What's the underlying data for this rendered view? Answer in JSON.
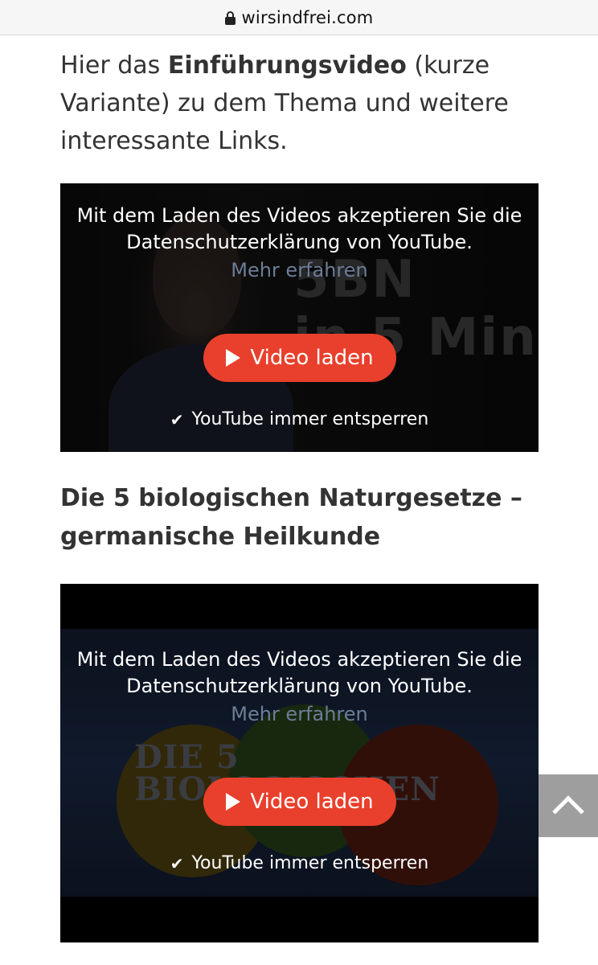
{
  "browser": {
    "url": "wirsindfrei.com"
  },
  "intro": {
    "text_before": "Hier das ",
    "bold": "Einführungsvideo",
    "text_after": " (kurze Variante) zu dem Thema und weitere interessante Links."
  },
  "video1": {
    "thumb_line1": "5BN",
    "thumb_line2": "in 5 Min",
    "consent_text": "Mit dem Laden des Videos akzeptieren Sie die Datenschutzerklärung von YouTube.",
    "more_link": "Mehr erfahren",
    "load_button": "Video laden",
    "unlock_label": "YouTube immer entsperren"
  },
  "section": {
    "title": "Die 5 biologischen Naturgesetze – germanische Heilkunde"
  },
  "video2": {
    "thumb_line1": "DIE 5 BIOLOGISCHEN",
    "thumb_line2": "N          E",
    "consent_text": "Mit dem Laden des Videos akzeptieren Sie die Datenschutzerklärung von YouTube.",
    "more_link": "Mehr erfahren",
    "load_button": "Video laden",
    "unlock_label": "YouTube immer entsperren"
  },
  "icons": {
    "lock": "lock-icon",
    "play": "play-icon",
    "check": "check-icon",
    "scroll_top": "chevron-up-icon"
  },
  "colors": {
    "button": "#e8402c",
    "link": "#6c7d97",
    "scroll_button": "#9e9e9e"
  }
}
